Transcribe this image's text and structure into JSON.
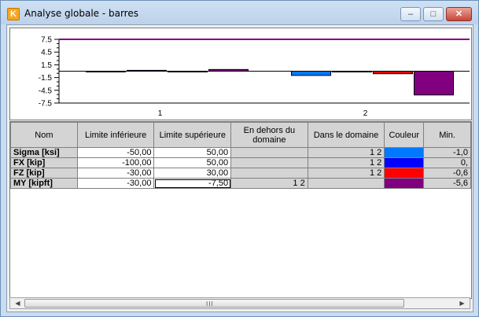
{
  "window": {
    "title": "Analyse globale - barres",
    "app_icon": "app-logo-icon",
    "min_glyph": "–",
    "max_glyph": "□",
    "close_glyph": "✕"
  },
  "chart_data": {
    "type": "bar",
    "categories": [
      "1",
      "2"
    ],
    "y_ticks": [
      "7.5",
      "4.5",
      "1.5",
      "-1.5",
      "-4.5",
      "-7.5"
    ],
    "ylim": [
      -7.5,
      7.5
    ],
    "reference_line": {
      "y": 7.5,
      "color": "#800080"
    },
    "series": [
      {
        "color": "#0078ff",
        "values": [
          0.0,
          -1.0
        ]
      },
      {
        "color": "#0000ff",
        "values": [
          0.2,
          0.0
        ]
      },
      {
        "color": "#ff0000",
        "values": [
          0.0,
          -0.6
        ]
      },
      {
        "color": "#800080",
        "values": [
          0.4,
          -5.6
        ]
      }
    ]
  },
  "grid": {
    "headers": [
      "Nom",
      "Limite inférieure",
      "Limite supérieure",
      "En dehors du domaine",
      "Dans le domaine",
      "Couleur",
      "Min."
    ],
    "rows": [
      {
        "name": "Sigma [ksi]",
        "lower": "-50,00",
        "upper": "50,00",
        "outside": "",
        "inside": "1 2",
        "color": "#0078ff",
        "min": "-1,0"
      },
      {
        "name": "FX [kip]",
        "lower": "-100,00",
        "upper": "50,00",
        "outside": "",
        "inside": "1 2",
        "color": "#0000ff",
        "min": "0,"
      },
      {
        "name": "FZ [kip]",
        "lower": "-30,00",
        "upper": "30,00",
        "outside": "",
        "inside": "1 2",
        "color": "#ff0000",
        "min": "-0,6"
      },
      {
        "name": "MY [kipft]",
        "lower": "-30,00",
        "upper": "-7,50",
        "outside": "1 2",
        "inside": "",
        "color": "#800080",
        "min": "-5,6"
      }
    ]
  },
  "scrollbar": {
    "left_glyph": "◀",
    "right_glyph": "▶",
    "grip_glyph": "III"
  }
}
